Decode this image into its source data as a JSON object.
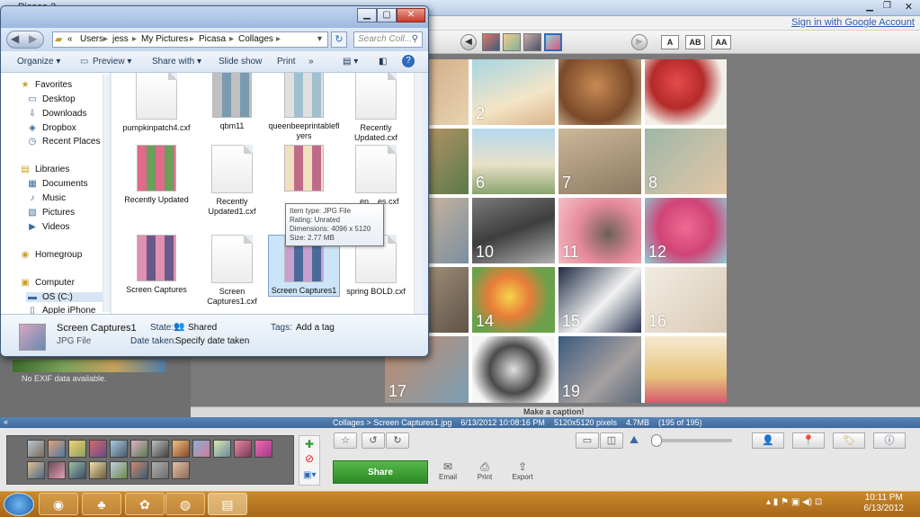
{
  "picasa": {
    "window_title": "Picasa 3",
    "signin_link": "Sign in with Google Account",
    "text_size_buttons": [
      "A",
      "AB",
      "AA"
    ],
    "collage_numbers": [
      "2",
      "6",
      "7",
      "8",
      "10",
      "11",
      "12",
      "14",
      "15",
      "16",
      "17",
      "19"
    ],
    "exif_text": "No EXIF data available.",
    "caption_placeholder": "Make a caption!",
    "status": {
      "path": "Collages > Screen Captures1.jpg",
      "datetime": "6/13/2012 10:08:16 PM",
      "dimensions": "5120x5120 pixels",
      "size": "4.7MB",
      "count": "(195 of 195)"
    },
    "actions": {
      "share": "Share",
      "email": "Email",
      "print": "Print",
      "export": "Export"
    }
  },
  "explorer": {
    "breadcrumbs": [
      "«",
      "Users",
      "jess",
      "My Pictures",
      "Picasa",
      "Collages"
    ],
    "search_placeholder": "Search Coll...",
    "commands": [
      "Organize ▾",
      "Preview ▾",
      "Share with ▾",
      "Slide show",
      "Print",
      "»"
    ],
    "nav": [
      {
        "label": "Favorites",
        "icon": "★",
        "group": true
      },
      {
        "label": "Desktop",
        "icon": "▭"
      },
      {
        "label": "Downloads",
        "icon": "⇩"
      },
      {
        "label": "Dropbox",
        "icon": "◈"
      },
      {
        "label": "Recent Places",
        "icon": "◷"
      },
      {
        "label": "Libraries",
        "icon": "▤",
        "group": true
      },
      {
        "label": "Documents",
        "icon": "▦"
      },
      {
        "label": "Music",
        "icon": "♪"
      },
      {
        "label": "Pictures",
        "icon": "▧"
      },
      {
        "label": "Videos",
        "icon": "▶"
      },
      {
        "label": "Homegroup",
        "icon": "◉",
        "group": true
      },
      {
        "label": "Computer",
        "icon": "▣",
        "group": true
      },
      {
        "label": "OS (C:)",
        "icon": "▬"
      },
      {
        "label": "Apple iPhone",
        "icon": "▯"
      }
    ],
    "files": [
      {
        "name": "pumpkinpatch4.cxf",
        "type": "doc"
      },
      {
        "name": "qbm11",
        "type": "img"
      },
      {
        "name": "queenbeeprintablefl yers",
        "type": "img"
      },
      {
        "name": "Recently Updated.cxf",
        "type": "doc"
      },
      {
        "name": "Recently Updated",
        "type": "img"
      },
      {
        "name": "Recently Updated1.cxf",
        "type": "doc"
      },
      {
        "name": "",
        "type": "img"
      },
      {
        "name": "...en ...es.cxf",
        "type": "doc"
      },
      {
        "name": "Screen Captures",
        "type": "img"
      },
      {
        "name": "Screen Captures1.cxf",
        "type": "doc"
      },
      {
        "name": "Screen Captures1",
        "type": "img",
        "selected": true
      },
      {
        "name": "spring BOLD.cxf",
        "type": "doc"
      }
    ],
    "tooltip": {
      "item_type": "Item type: JPG File",
      "rating": "Rating: Unrated",
      "dimensions": "Dimensions: 4096 x 5120",
      "size": "Size: 2.77 MB"
    },
    "details": {
      "filename": "Screen Captures1",
      "filetype": "JPG File",
      "state_label": "State:",
      "state_value": "Shared",
      "tags_label": "Tags:",
      "tags_value": "Add a tag",
      "date_label": "Date taken:",
      "date_value": "Specify date taken"
    }
  },
  "taskbar": {
    "time": "10:11 PM",
    "date": "6/13/2012"
  }
}
